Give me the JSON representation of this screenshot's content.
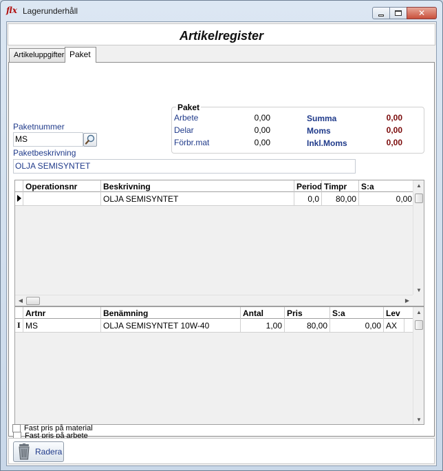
{
  "window": {
    "title": "Lagerunderhåll",
    "logo_text": "flx"
  },
  "header": {
    "title": "Artikelregister"
  },
  "tabs": [
    {
      "label": "Artikeluppgifter",
      "active": false
    },
    {
      "label": "Paket",
      "active": true
    }
  ],
  "form": {
    "paketnummer_label": "Paketnummer",
    "paketnummer_value": "MS",
    "paketbeskrivning_label": "Paketbeskrivning",
    "paketbeskrivning_value": "OLJA  SEMISYNTET"
  },
  "paket_summary": {
    "title": "Paket",
    "rows": [
      {
        "label": "Arbete",
        "value": "0,00",
        "total_label": "Summa",
        "total_value": "0,00"
      },
      {
        "label": "Delar",
        "value": "0,00",
        "total_label": "Moms",
        "total_value": "0,00"
      },
      {
        "label": "Förbr.mat",
        "value": "0,00",
        "total_label": "Inkl.Moms",
        "total_value": "0,00"
      }
    ]
  },
  "operations_grid": {
    "columns": [
      "Operationsnr",
      "Beskrivning",
      "Period",
      "Timpr",
      "S:a"
    ],
    "rows": [
      {
        "operationsnr": "",
        "beskrivning": "OLJA SEMISYNTET",
        "period": "0,0",
        "timpr": "80,00",
        "sa": "0,00"
      }
    ]
  },
  "articles_grid": {
    "columns": [
      "Artnr",
      "Benämning",
      "Antal",
      "Pris",
      "S:a",
      "Lev"
    ],
    "rows": [
      {
        "artnr": "MS",
        "benamning": "OLJA SEMISYNTET 10W-40",
        "antal": "1,00",
        "pris": "80,00",
        "sa": "0,00",
        "lev": "AX"
      }
    ]
  },
  "options": {
    "fast_pris_arbete": "Fast pris på arbete",
    "fast_pris_material": "Fast pris på material"
  },
  "toolbar": {
    "radera_label": "Radera"
  },
  "colors": {
    "label_blue": "#1f3a8a",
    "total_red": "#7a0a0a"
  }
}
